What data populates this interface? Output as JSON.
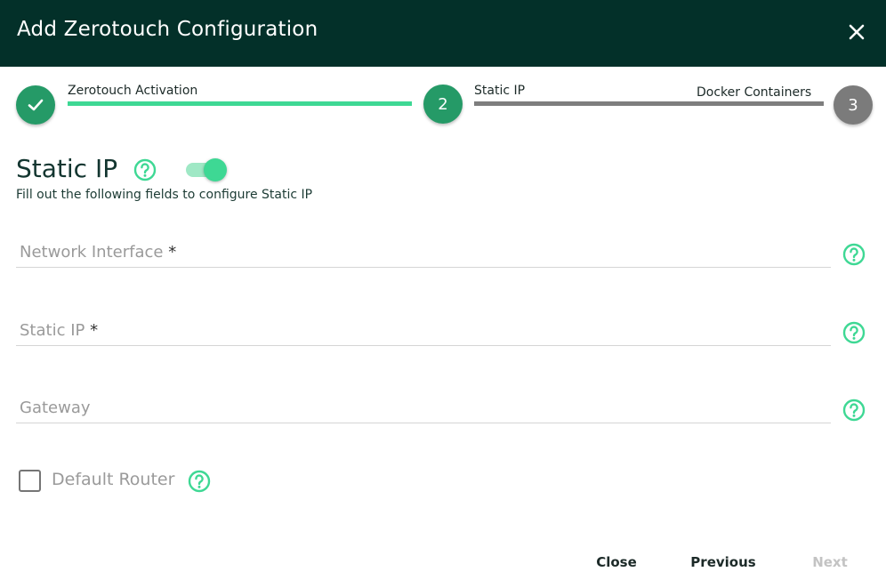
{
  "dialog": {
    "title": "Add Zerotouch Configuration"
  },
  "stepper": {
    "steps": [
      {
        "label": "Zerotouch Activation",
        "number": "1",
        "status": "completed"
      },
      {
        "label": "Static IP",
        "number": "2",
        "status": "active"
      },
      {
        "label": "Docker Containers",
        "number": "3",
        "status": "pending"
      }
    ]
  },
  "section": {
    "title": "Static IP",
    "toggle_on": true,
    "subtitle": "Fill out the following fields to configure Static IP"
  },
  "fields": [
    {
      "label": "Network Interface",
      "required_mark": "*",
      "value": ""
    },
    {
      "label": "Static IP",
      "required_mark": "*",
      "value": ""
    },
    {
      "label": "Gateway",
      "required_mark": "",
      "value": ""
    }
  ],
  "checkbox": {
    "label": "Default Router",
    "checked": false
  },
  "actions": {
    "close": "Close",
    "previous": "Previous",
    "next": "Next"
  },
  "colors": {
    "header_bg": "#033029",
    "accent": "#3ed894",
    "step_done": "#259a67",
    "step_pending": "#7b7b7b",
    "disabled_text": "#c3c3c3"
  },
  "icons": {
    "close": "close-icon",
    "check": "check-icon",
    "help": "help-circle-icon"
  }
}
